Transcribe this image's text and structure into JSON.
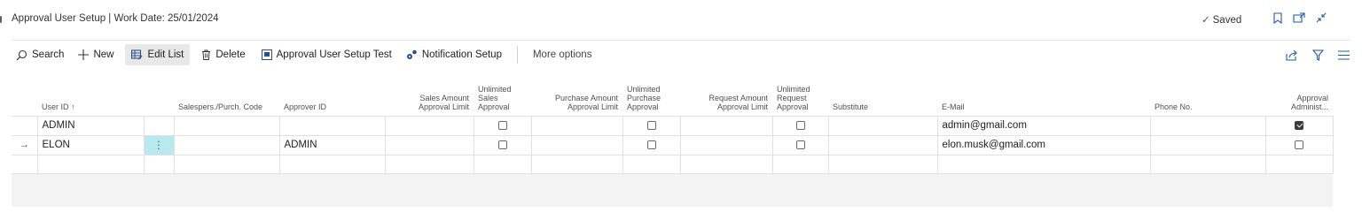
{
  "header": {
    "page_title": "Approval User Setup | Work Date: 25/01/2024",
    "saved_label": "Saved",
    "icons": [
      "bookmark-icon",
      "open-new-window-icon",
      "collapse-icon"
    ]
  },
  "actions": [
    {
      "name": "search",
      "icon": "search-icon",
      "label": "Search"
    },
    {
      "name": "new",
      "icon": "plus-icon",
      "label": "New"
    },
    {
      "name": "edit-list",
      "icon": "edit-list-icon",
      "label": "Edit List",
      "selected": true
    },
    {
      "name": "delete",
      "icon": "trash-icon",
      "label": "Delete"
    },
    {
      "name": "approval-user-setup-test",
      "icon": "report-icon",
      "label": "Approval User Setup Test"
    },
    {
      "name": "notification-setup",
      "icon": "settings-icon",
      "label": "Notification Setup"
    },
    {
      "name": "more-options",
      "label": "More options"
    }
  ],
  "toolbar_right_icons": [
    "share-icon",
    "filter-icon",
    "list-view-icon"
  ],
  "columns": {
    "user_id": "User ID ↑",
    "salespers": "Salespers./Purch. Code",
    "approver_id": "Approver ID",
    "sales_limit": [
      "Sales Amount",
      "Approval Limit"
    ],
    "unl_sales": [
      "Unlimited",
      "Sales",
      "Approval"
    ],
    "purchase_limit": [
      "Purchase Amount",
      "Approval Limit"
    ],
    "unl_purchase": [
      "Unlimited",
      "Purchase",
      "Approval"
    ],
    "request_limit": [
      "Request Amount",
      "Approval Limit"
    ],
    "unl_request": [
      "Unlimited",
      "Request",
      "Approval"
    ],
    "substitute": "Substitute",
    "email": "E-Mail",
    "phone": "Phone No.",
    "approval_admin": [
      "Approval",
      "Administ..."
    ]
  },
  "rows": [
    {
      "indicator": "",
      "user_id": "ADMIN",
      "salespers": "",
      "approver_id": "",
      "sales_limit": "",
      "unlimited_sales": false,
      "purchase_limit": "",
      "unlimited_purchase": false,
      "request_limit": "",
      "unlimited_request": false,
      "substitute": "",
      "email": "admin@gmail.com",
      "phone": "",
      "approval_administrator": true
    },
    {
      "indicator": "→",
      "user_id": "ELON",
      "salespers": "",
      "approver_id": "ADMIN",
      "sales_limit": "",
      "unlimited_sales": false,
      "purchase_limit": "",
      "unlimited_purchase": false,
      "request_limit": "",
      "unlimited_request": false,
      "substitute": "",
      "email": "elon.musk@gmail.com",
      "phone": "",
      "approval_administrator": false,
      "row_menu": "⋮"
    }
  ],
  "colors": {
    "accent": "#b7e9ef",
    "selected_action_bg": "#e8e8e8",
    "grid_border": "#e1e1e1"
  }
}
